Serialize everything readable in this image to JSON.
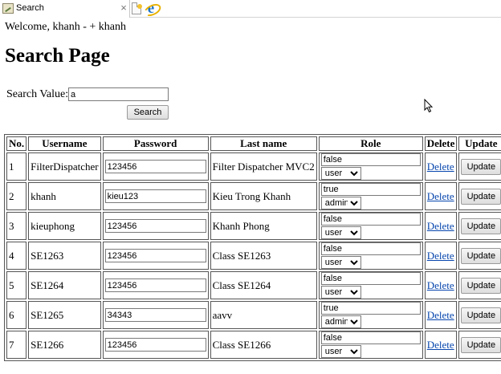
{
  "browser": {
    "tab_title": "Search",
    "tab_close": "×"
  },
  "welcome_text": "Welcome, khanh - + khanh",
  "page_title": "Search Page",
  "search": {
    "label": "Search Value:",
    "value": "a",
    "button_label": "Search"
  },
  "table": {
    "headers": [
      "No.",
      "Username",
      "Password",
      "Last name",
      "Role",
      "Delete",
      "Update"
    ],
    "delete_label": "Delete",
    "update_label": "Update",
    "rows": [
      {
        "no": "1",
        "username": "FilterDispatcher",
        "password": "123456",
        "last_name": "Filter Dispatcher MVC2",
        "role_text": "false",
        "role_select": "user"
      },
      {
        "no": "2",
        "username": "khanh",
        "password": "kieu123",
        "last_name": "Kieu Trong Khanh",
        "role_text": "true",
        "role_select": "admin"
      },
      {
        "no": "3",
        "username": "kieuphong",
        "password": "123456",
        "last_name": "Khanh Phong",
        "role_text": "false",
        "role_select": "user"
      },
      {
        "no": "4",
        "username": "SE1263",
        "password": "123456",
        "last_name": "Class SE1263",
        "role_text": "false",
        "role_select": "user"
      },
      {
        "no": "5",
        "username": "SE1264",
        "password": "123456",
        "last_name": "Class SE1264",
        "role_text": "false",
        "role_select": "user"
      },
      {
        "no": "6",
        "username": "SE1265",
        "password": "34343",
        "last_name": "aavv",
        "role_text": "true",
        "role_select": "admin"
      },
      {
        "no": "7",
        "username": "SE1266",
        "password": "123456",
        "last_name": "Class SE1266",
        "role_text": "false",
        "role_select": "user"
      }
    ]
  },
  "icons": {
    "tab_favicon": "picture-icon",
    "new_tab": "new-tab-icon",
    "browser": "internet-explorer-icon",
    "cursor": "mouse-pointer-icon"
  }
}
